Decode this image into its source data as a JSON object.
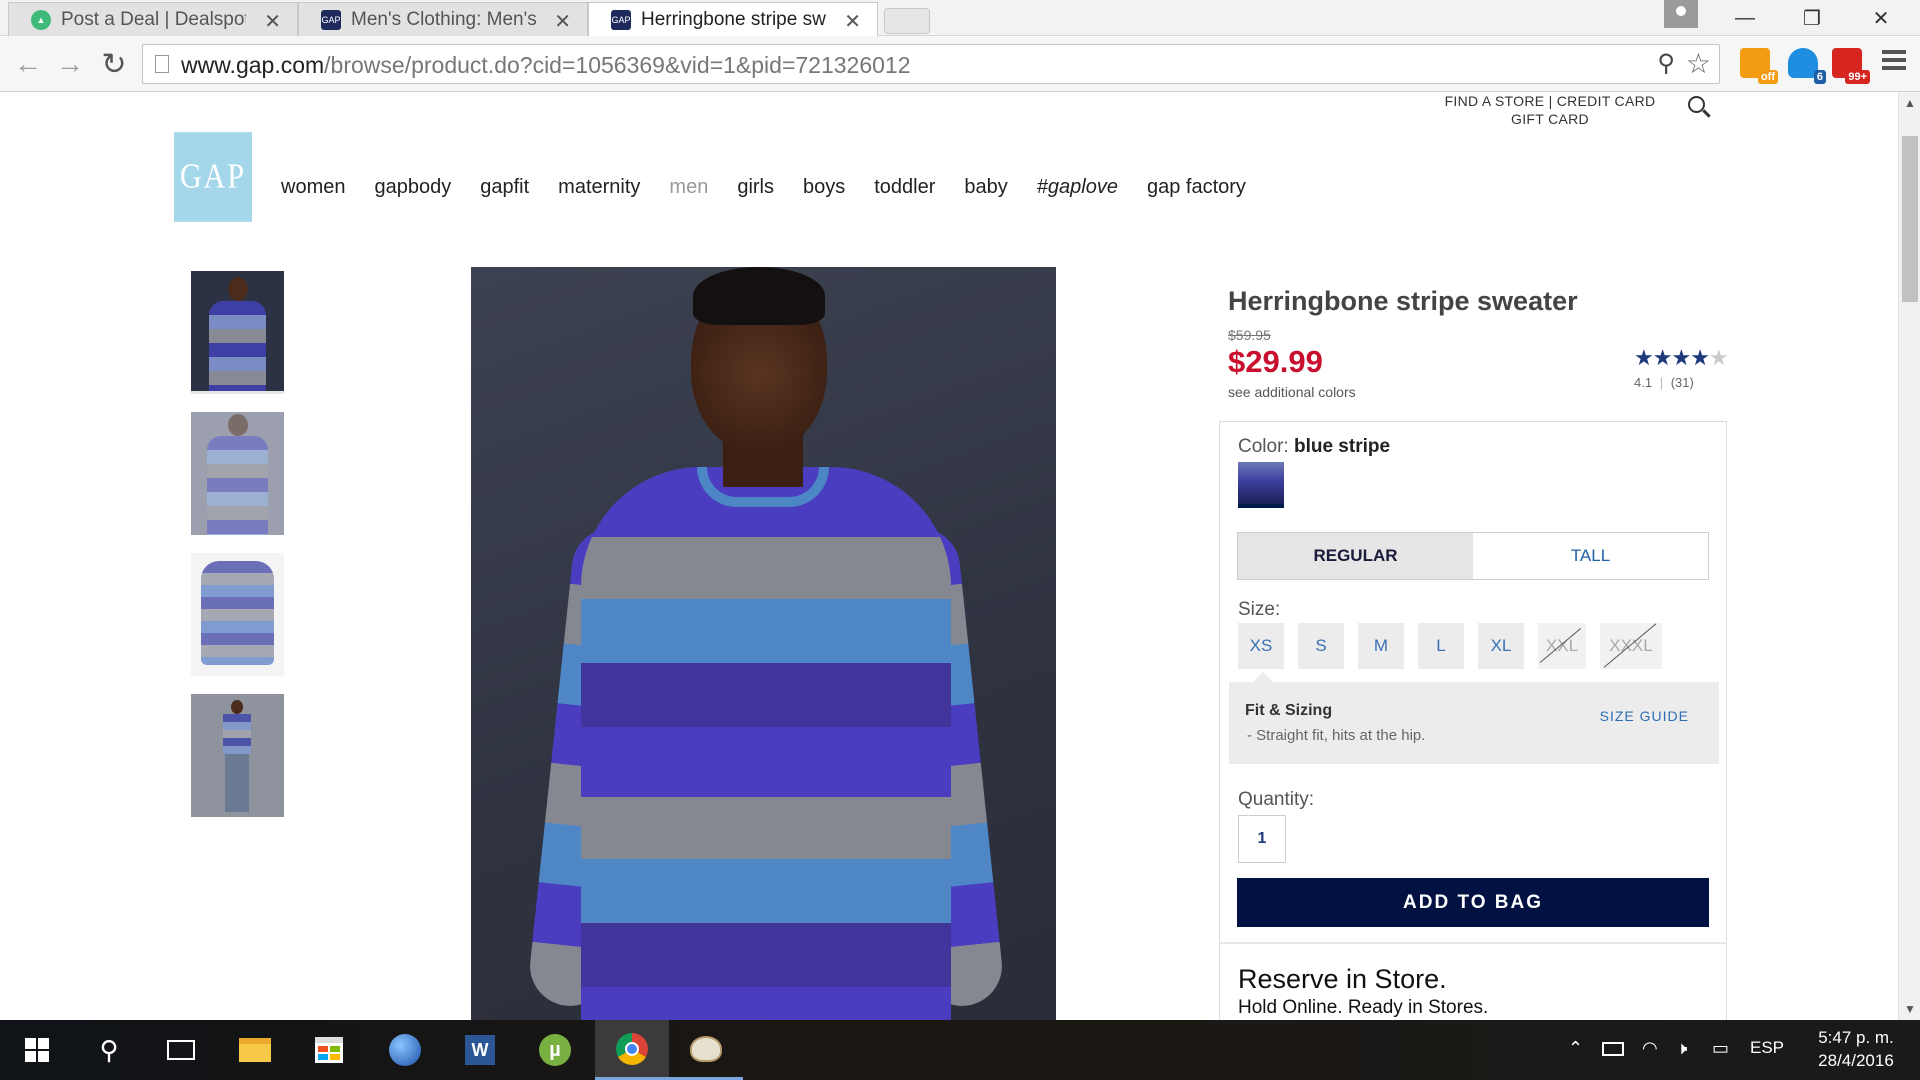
{
  "browser": {
    "tabs": [
      {
        "title": "Post a Deal | Dealspotr",
        "active": false
      },
      {
        "title": "Men's Clothing: Men's Clo",
        "active": false
      },
      {
        "title": "Herringbone stripe sweate",
        "active": true
      }
    ],
    "url_host": "www.gap.com",
    "url_path": "/browse/product.do?cid=1056369&vid=1&pid=721326012",
    "extensions": [
      {
        "name": "honey-extension-icon",
        "badge": "off",
        "color": "#f39c12"
      },
      {
        "name": "ghostery-extension-icon",
        "badge": "6",
        "color": "#1f8de0"
      },
      {
        "name": "lastpass-extension-icon",
        "badge": "99+",
        "color": "#d6261f"
      }
    ]
  },
  "header": {
    "utility_line1": "FIND A STORE | CREDIT CARD",
    "utility_line2": "GIFT CARD",
    "logo_text": "GAP",
    "nav": [
      "women",
      "gapbody",
      "gapfit",
      "maternity",
      "men",
      "girls",
      "boys",
      "toddler",
      "baby",
      "#gaplove",
      "gap factory"
    ],
    "nav_current": "men"
  },
  "product": {
    "name": "Herringbone stripe sweater",
    "original_price": "$59.95",
    "sale_price": "$29.99",
    "additional_colors": "see additional colors",
    "rating_stars_filled": 4,
    "rating_stars_total": 5,
    "rating_value": "4.1",
    "rating_separator": "|",
    "review_count": "(31)"
  },
  "options": {
    "color_label": "Color:",
    "color_value": "blue stripe",
    "fit_types": [
      "REGULAR",
      "TALL"
    ],
    "fit_selected": "REGULAR",
    "size_label": "Size:",
    "sizes": [
      {
        "label": "XS",
        "available": true
      },
      {
        "label": "S",
        "available": true
      },
      {
        "label": "M",
        "available": true
      },
      {
        "label": "L",
        "available": true
      },
      {
        "label": "XL",
        "available": true
      },
      {
        "label": "XXL",
        "available": false
      },
      {
        "label": "XXXL",
        "available": false
      }
    ],
    "fit_title": "Fit & Sizing",
    "fit_description": "- Straight fit, hits at the hip.",
    "size_guide": "SIZE GUIDE",
    "quantity_label": "Quantity:",
    "quantity_value": "1",
    "add_to_bag": "ADD TO BAG"
  },
  "reserve": {
    "title": "Reserve in Store.",
    "subtitle": "Hold Online. Ready in Stores."
  },
  "taskbar": {
    "language": "ESP",
    "time": "5:47 p. m.",
    "date": "28/4/2016"
  },
  "colors": {
    "sale_red": "#c8102e",
    "gap_navy": "#001142",
    "logo_blue": "#a5d7ea",
    "link_blue": "#2e6db4"
  }
}
